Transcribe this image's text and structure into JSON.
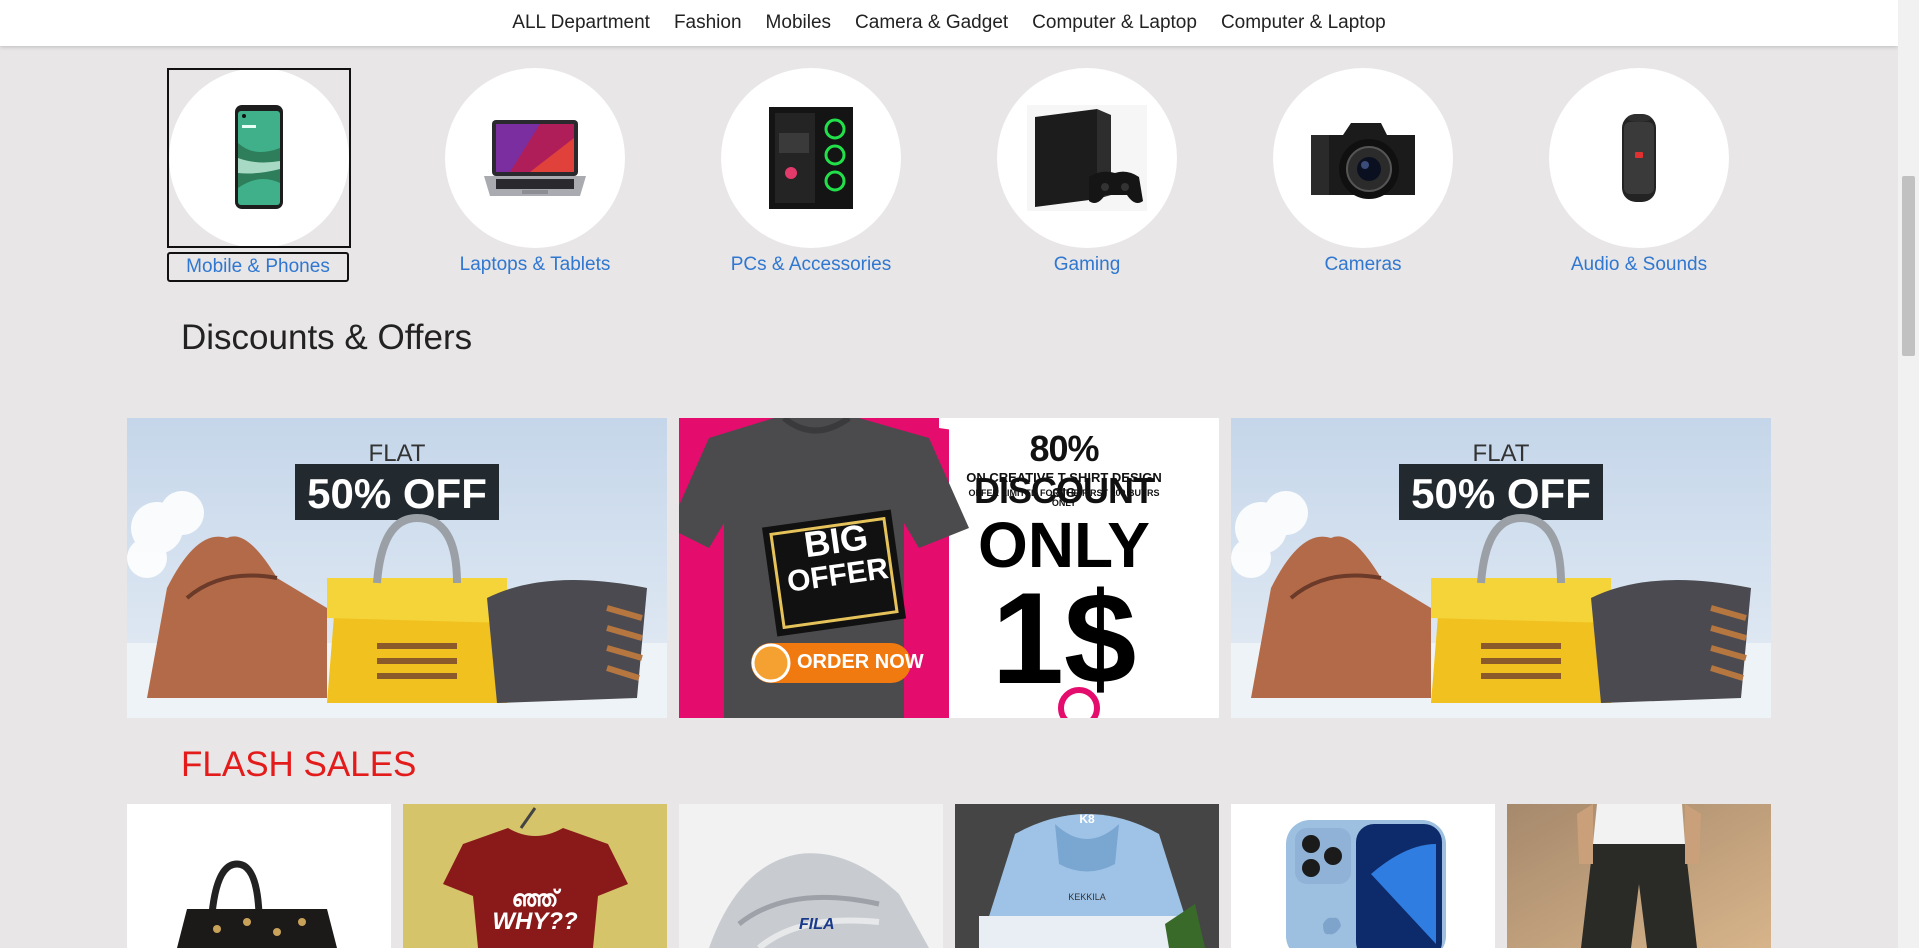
{
  "nav": {
    "items": [
      "ALL Department",
      "Fashion",
      "Mobiles",
      "Camera & Gadget",
      "Computer & Laptop",
      "Computer & Laptop"
    ]
  },
  "categories": [
    {
      "label": "Mobile & Phones",
      "icon": "smartphone-image"
    },
    {
      "label": "Laptops & Tablets",
      "icon": "laptop-image"
    },
    {
      "label": "PCs & Accessories",
      "icon": "gaming-pc-image"
    },
    {
      "label": "Gaming",
      "icon": "playstation-image"
    },
    {
      "label": "Cameras",
      "icon": "dslr-camera-image"
    },
    {
      "label": "Audio & Sounds",
      "icon": "speaker-image"
    }
  ],
  "offers": {
    "title": "Discounts & Offers",
    "banner1": {
      "flat": "FLAT",
      "off": "50% OFF"
    },
    "banner2": {
      "headline": "80% DISCOUNT",
      "sub1": "ON CREATIVE T-SHIRT DESIGN GIG",
      "sub2": "OFFER LIMITED FOR THE FIRST 100 BUYRS ONLY",
      "only": "ONLY",
      "price": "1$",
      "big": "BIG",
      "offer": "OFFER",
      "cta": "ORDER NOW"
    },
    "banner3": {
      "flat": "FLAT",
      "off": "50% OFF"
    }
  },
  "flash": {
    "title": "FLASH SALES",
    "tshirt_text": "ഞ്ഞ്",
    "tshirt_why": "WHY??",
    "shoe_brand": "FILA",
    "hoodie_brand": "KEKKILA",
    "hoodie_logo": "K8"
  },
  "colors": {
    "link": "#2f77d1",
    "flash": "#e31b1b",
    "accent_pink": "#e40c6c",
    "order_orange": "#f07a10"
  }
}
